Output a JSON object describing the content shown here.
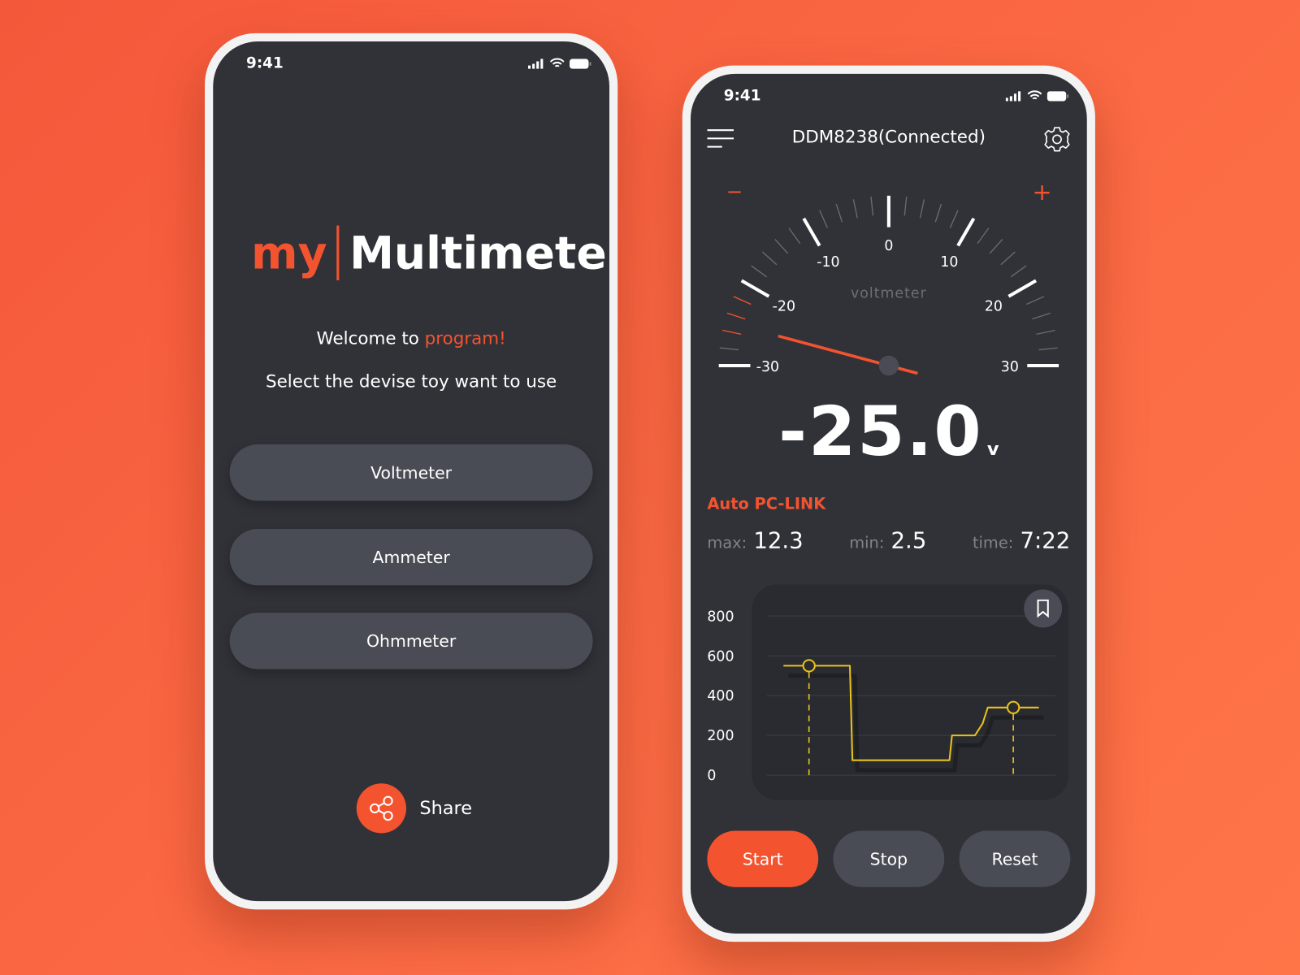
{
  "status_bar": {
    "time": "9:41"
  },
  "home": {
    "logo_my": "my",
    "logo_name": "Multimeter",
    "welcome_prefix": "Welcome to ",
    "welcome_highlight": "program!",
    "subtitle": "Select the devise toy want to use",
    "devices": [
      {
        "label": "Voltmeter"
      },
      {
        "label": "Ammeter"
      },
      {
        "label": "Ohmmeter"
      }
    ],
    "share_label": "Share",
    "share_icon": "share-icon"
  },
  "meter": {
    "title": "DDM8238(Connected)",
    "menu_icon": "menu-icon",
    "settings_icon": "gear-icon",
    "gauge": {
      "label": "voltmeter",
      "minus": "−",
      "plus": "+",
      "ticks": [
        "-30",
        "-20",
        "-10",
        "0",
        "10",
        "20",
        "30"
      ],
      "range": [
        -30,
        30
      ],
      "needle_value": -25
    },
    "reading": "-25.0",
    "unit": "v",
    "mode": "Auto PC-LINK",
    "stats": {
      "max_label": "max:",
      "max": "12.3",
      "min_label": "min:",
      "min": "2.5",
      "time_label": "time:",
      "time": "7:22"
    },
    "buttons": {
      "start": "Start",
      "stop": "Stop",
      "reset": "Reset"
    },
    "bookmark_icon": "bookmark-icon"
  },
  "colors": {
    "accent": "#f4532f",
    "screen": "#313238",
    "button": "#4a4c55",
    "trace": "#e8c21c"
  },
  "chart_data": {
    "type": "line",
    "y_ticks": [
      "800",
      "600",
      "400",
      "200",
      "0"
    ],
    "ylim": [
      0,
      800
    ],
    "grid": true,
    "points": [
      [
        0,
        550
      ],
      [
        1,
        550
      ],
      [
        2,
        550
      ],
      [
        2.6,
        550
      ],
      [
        2.7,
        75
      ],
      [
        5,
        75
      ],
      [
        6.5,
        75
      ],
      [
        6.6,
        200
      ],
      [
        7.5,
        200
      ],
      [
        7.8,
        260
      ],
      [
        8,
        340
      ],
      [
        9,
        340
      ],
      [
        10,
        340
      ]
    ],
    "markers": [
      [
        1,
        550
      ],
      [
        9,
        340
      ]
    ]
  }
}
